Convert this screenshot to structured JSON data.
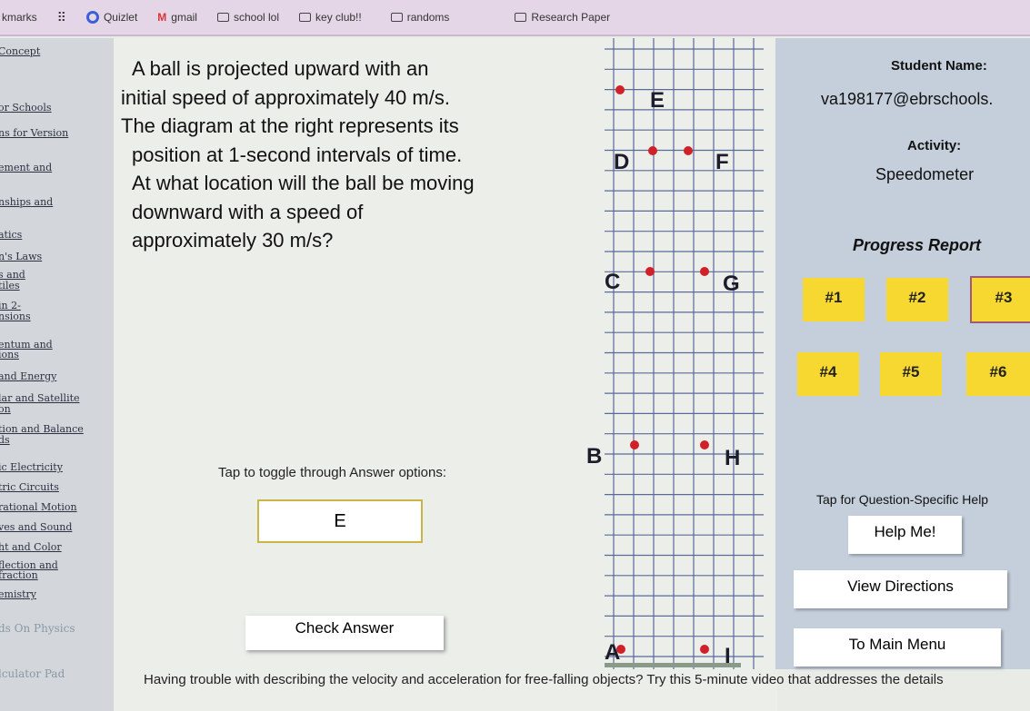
{
  "bookmarks": [
    {
      "label": "kmarks",
      "icon": "bookmark-icon"
    },
    {
      "label": "",
      "icon": "apps-grid-icon"
    },
    {
      "label": "Quizlet",
      "icon": "quizlet-icon"
    },
    {
      "label": "gmail",
      "icon": "gmail-icon"
    },
    {
      "label": "school lol",
      "icon": "folder-icon"
    },
    {
      "label": "key club!!",
      "icon": "folder-icon"
    },
    {
      "label": "randoms",
      "icon": "folder-icon"
    },
    {
      "label": "Research Paper",
      "icon": "folder-icon"
    }
  ],
  "sidebar": {
    "items": [
      "Concept",
      "",
      "or Schools",
      "ns for Version",
      "ement and",
      "nships and",
      "atics",
      "n's Laws",
      "s and",
      "tiles",
      "in 2-",
      "nsions",
      "entum and",
      "ions",
      "and Energy",
      "lar and Satellite",
      "on",
      "tion and Balance",
      "ds",
      "ic Electricity",
      "tric Circuits",
      "rational Motion",
      "ves and Sound",
      "ht and Color",
      "flection and",
      "fraction",
      "emistry"
    ],
    "footer": [
      "ds On Physics",
      "lculator Pad"
    ]
  },
  "question": {
    "lines": [
      "A ball is projected upward with an",
      "initial speed of approximately 40 m/s.",
      "The diagram at the right represents its",
      "position at 1-second intervals of time.",
      "At what location will the ball be moving",
      "downward with a speed of",
      "approximately 30 m/s?"
    ]
  },
  "diagram": {
    "labels": [
      "A",
      "B",
      "C",
      "D",
      "E",
      "F",
      "G",
      "H",
      "I"
    ],
    "point_color": "#d0202a"
  },
  "answer": {
    "toggle_label": "Tap to toggle through Answer options:",
    "value": "E",
    "check_label": "Check Answer"
  },
  "bottom_text": "Having trouble with describing the velocity and acceleration for free-falling objects? Try this 5-minute video that addresses the details",
  "right": {
    "student_name_label": "Student Name:",
    "student_email": "va198177@ebrschools.",
    "activity_label": "Activity:",
    "activity": "Speedometer",
    "progress_title": "Progress Report",
    "progress": [
      "#1",
      "#2",
      "#3",
      "#4",
      "#5",
      "#6"
    ],
    "current": "#3",
    "help_hint": "Tap for Question-Specific Help",
    "help": "Help Me!",
    "directions": "View Directions",
    "menu": "To Main Menu"
  },
  "colors": {
    "progress_button": "#f6d830",
    "panel": "#c5cfdc",
    "progress_title": "#1a1a1a"
  }
}
